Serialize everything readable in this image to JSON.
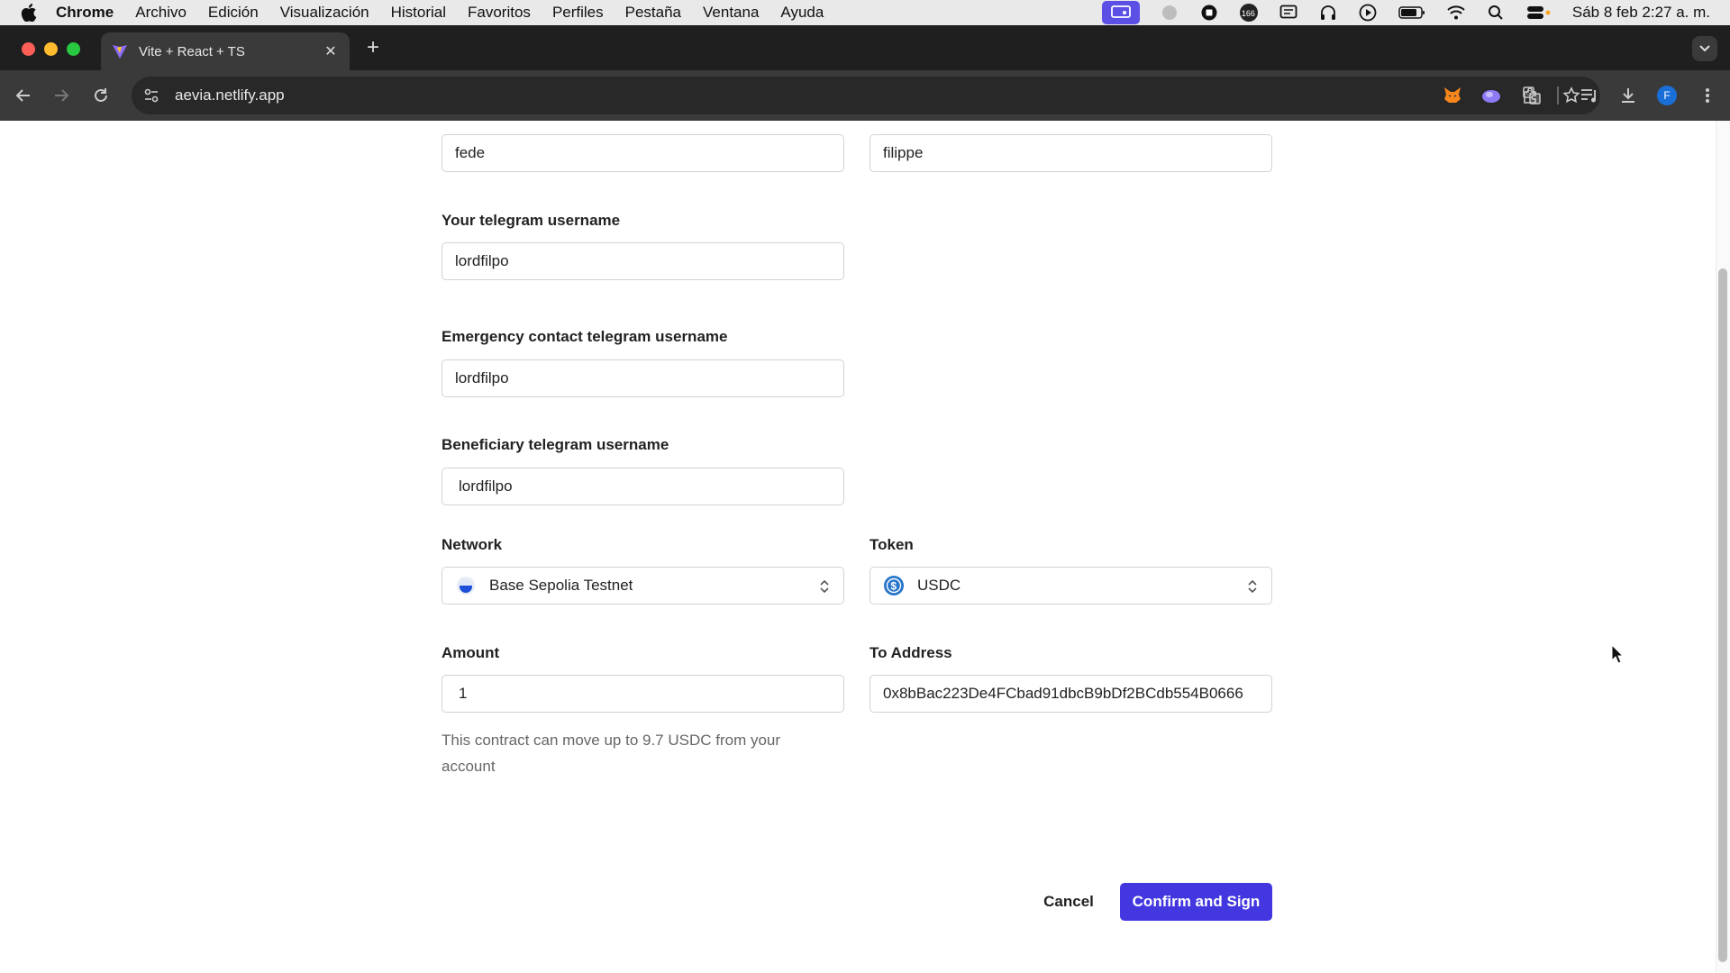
{
  "menubar": {
    "app": "Chrome",
    "items": [
      "Archivo",
      "Edición",
      "Visualización",
      "Historial",
      "Favoritos",
      "Perfiles",
      "Pestaña",
      "Ventana",
      "Ayuda"
    ],
    "clock": "Sáb 8 feb  2:27 a. m.",
    "badge_count": "166"
  },
  "browser": {
    "tab_title": "Vite + React + TS",
    "url": "aevia.netlify.app",
    "profile_initial": "F"
  },
  "form": {
    "first_name_value": "fede",
    "last_name_value": "filippe",
    "telegram_label": "Your telegram username",
    "telegram_value": "lordfilpo",
    "emergency_label": "Emergency contact telegram username",
    "emergency_value": "lordfilpo",
    "beneficiary_label": "Beneficiary telegram username",
    "beneficiary_value": "lordfilpo",
    "network_label": "Network",
    "network_value": "Base Sepolia Testnet",
    "token_label": "Token",
    "token_value": "USDC",
    "amount_label": "Amount",
    "amount_value": "1",
    "to_address_label": "To Address",
    "to_address_value": "0x8bBac223De4FCbad91dbcB9bDf2BCdb554B0666",
    "helper_text": "This contract can move up to 9.7 USDC from your account"
  },
  "actions": {
    "cancel_label": "Cancel",
    "confirm_label": "Confirm and Sign"
  },
  "colors": {
    "primary": "#4338e0",
    "chrome_dark": "#1f1f1f",
    "chrome_toolbar": "#3a3a3a"
  }
}
